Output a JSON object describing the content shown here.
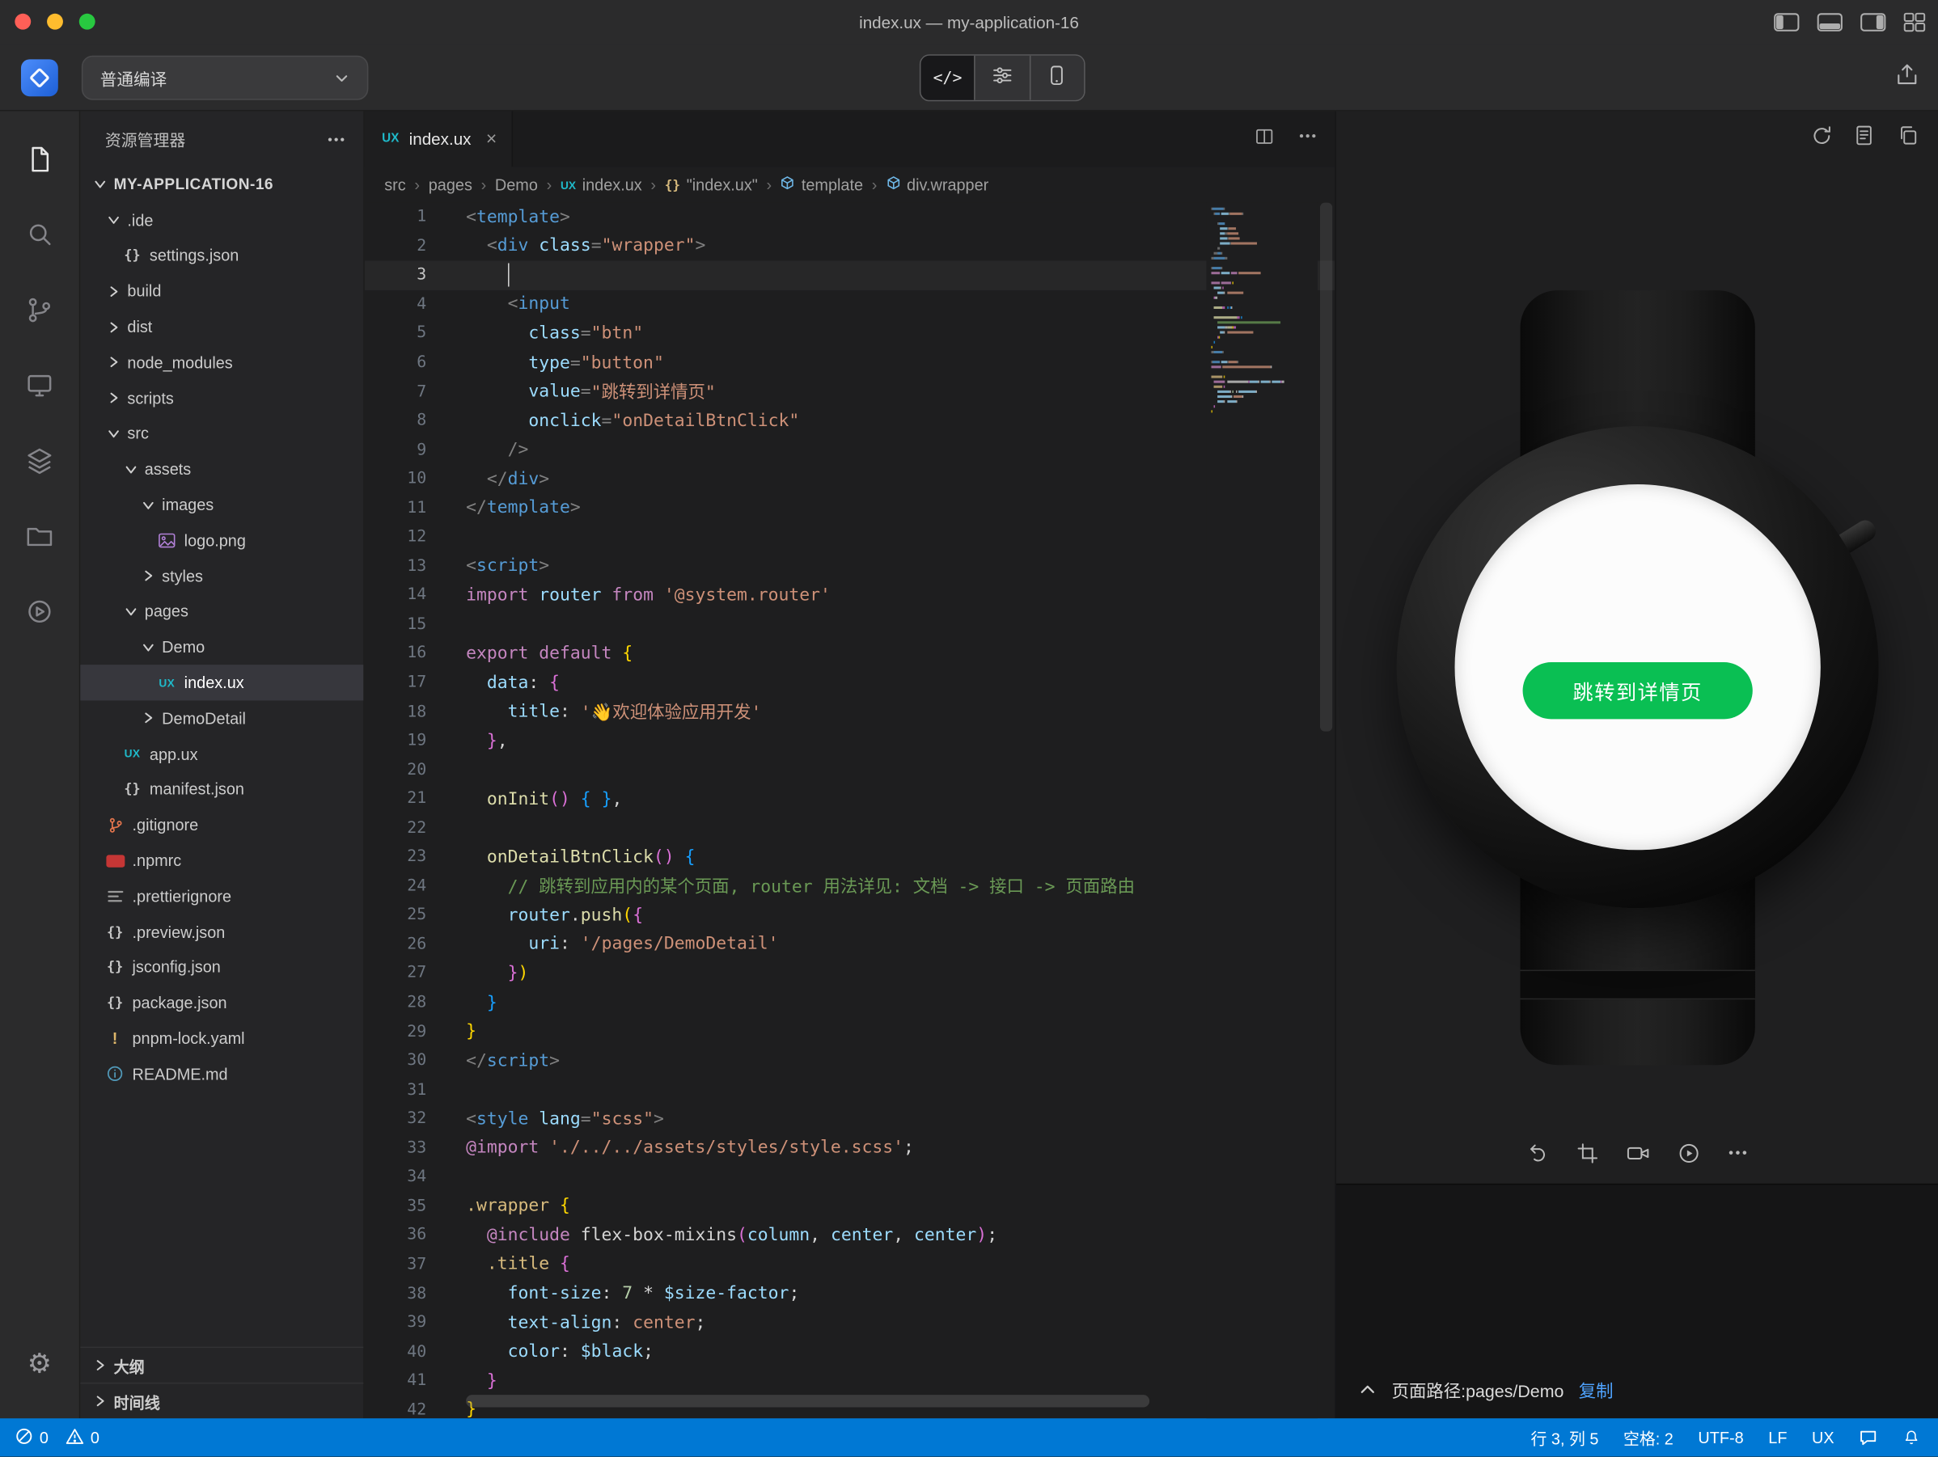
{
  "window": {
    "title": "index.ux — my-application-16"
  },
  "toolbar": {
    "compile_mode": "普通编译",
    "code_segment_label": "</>"
  },
  "colors": {
    "statusbar": "#0078d4",
    "button_green": "#0abf53",
    "ux_badge": "#1fb9c9",
    "link_blue": "#4fa3ff"
  },
  "sidebar": {
    "header": "资源管理器",
    "project": "MY-APPLICATION-16",
    "items": [
      {
        "label": ".ide",
        "type": "folder",
        "exp": "open",
        "level": 1
      },
      {
        "label": "settings.json",
        "type": "file",
        "icon": "json",
        "level": 2
      },
      {
        "label": "build",
        "type": "folder",
        "exp": "closed",
        "level": 1
      },
      {
        "label": "dist",
        "type": "folder",
        "exp": "closed",
        "level": 1
      },
      {
        "label": "node_modules",
        "type": "folder",
        "exp": "closed",
        "level": 1
      },
      {
        "label": "scripts",
        "type": "folder",
        "exp": "closed",
        "level": 1
      },
      {
        "label": "src",
        "type": "folder",
        "exp": "open",
        "level": 1
      },
      {
        "label": "assets",
        "type": "folder",
        "exp": "open",
        "level": 2
      },
      {
        "label": "images",
        "type": "folder",
        "exp": "open",
        "level": 3
      },
      {
        "label": "logo.png",
        "type": "file",
        "icon": "image",
        "level": 4
      },
      {
        "label": "styles",
        "type": "folder",
        "exp": "closed",
        "level": 3
      },
      {
        "label": "pages",
        "type": "folder",
        "exp": "open",
        "level": 2
      },
      {
        "label": "Demo",
        "type": "folder",
        "exp": "open",
        "level": 3
      },
      {
        "label": "index.ux",
        "type": "file",
        "icon": "ux",
        "level": 4,
        "selected": true
      },
      {
        "label": "DemoDetail",
        "type": "folder",
        "exp": "closed",
        "level": 3
      },
      {
        "label": "app.ux",
        "type": "file",
        "icon": "ux",
        "level": 2
      },
      {
        "label": "manifest.json",
        "type": "file",
        "icon": "json",
        "level": 2
      },
      {
        "label": ".gitignore",
        "type": "file",
        "icon": "git",
        "level": 1
      },
      {
        "label": ".npmrc",
        "type": "file",
        "icon": "npm",
        "level": 1
      },
      {
        "label": ".prettierignore",
        "type": "file",
        "icon": "lines",
        "level": 1
      },
      {
        "label": ".preview.json",
        "type": "file",
        "icon": "json",
        "level": 1
      },
      {
        "label": "jsconfig.json",
        "type": "file",
        "icon": "json",
        "level": 1
      },
      {
        "label": "package.json",
        "type": "file",
        "icon": "json",
        "level": 1
      },
      {
        "label": "pnpm-lock.yaml",
        "type": "file",
        "icon": "warn",
        "level": 1
      },
      {
        "label": "README.md",
        "type": "file",
        "icon": "info",
        "level": 1
      }
    ],
    "footer": [
      "大纲",
      "时间线"
    ]
  },
  "editor": {
    "tab": {
      "icon": "UX",
      "label": "index.ux"
    },
    "breadcrumb": [
      {
        "label": "src"
      },
      {
        "label": "pages"
      },
      {
        "label": "Demo"
      },
      {
        "label": "index.ux",
        "icon": "ux"
      },
      {
        "label": "\"index.ux\"",
        "icon": "json"
      },
      {
        "label": "template",
        "icon": "symbol"
      },
      {
        "label": "div.wrapper",
        "icon": "symbol"
      }
    ],
    "cursor": {
      "line": 3,
      "col": 5
    },
    "palette": {
      "p": "#d4d4d4",
      "t": "#569cd6",
      "a": "#9cdcfe",
      "s": "#ce9178",
      "k": "#c586c0",
      "f": "#dcdcaa",
      "c": "#6a9955",
      "n": "#b5cea8",
      "g": "#808080",
      "b1": "#ffd700",
      "b2": "#da70d6",
      "b3": "#179fff",
      "sel": "#d7ba7d"
    },
    "lines": [
      [
        [
          "<",
          "g"
        ],
        [
          "template",
          "t"
        ],
        [
          ">",
          "g"
        ]
      ],
      [
        [
          "  ",
          "p"
        ],
        [
          "<",
          "g"
        ],
        [
          "div",
          "t"
        ],
        [
          " ",
          "p"
        ],
        [
          "class",
          "a"
        ],
        [
          "=",
          "g"
        ],
        [
          "\"wrapper\"",
          "s"
        ],
        [
          ">",
          "g"
        ]
      ],
      [
        [
          "    ",
          "p"
        ]
      ],
      [
        [
          "    ",
          "p"
        ],
        [
          "<",
          "g"
        ],
        [
          "input",
          "t"
        ]
      ],
      [
        [
          "      ",
          "p"
        ],
        [
          "class",
          "a"
        ],
        [
          "=",
          "g"
        ],
        [
          "\"btn\"",
          "s"
        ]
      ],
      [
        [
          "      ",
          "p"
        ],
        [
          "type",
          "a"
        ],
        [
          "=",
          "g"
        ],
        [
          "\"button\"",
          "s"
        ]
      ],
      [
        [
          "      ",
          "p"
        ],
        [
          "value",
          "a"
        ],
        [
          "=",
          "g"
        ],
        [
          "\"跳转到详情页\"",
          "s"
        ]
      ],
      [
        [
          "      ",
          "p"
        ],
        [
          "onclick",
          "a"
        ],
        [
          "=",
          "g"
        ],
        [
          "\"onDetailBtnClick\"",
          "s"
        ]
      ],
      [
        [
          "    ",
          "p"
        ],
        [
          "/>",
          "g"
        ]
      ],
      [
        [
          "  ",
          "p"
        ],
        [
          "</",
          "g"
        ],
        [
          "div",
          "t"
        ],
        [
          ">",
          "g"
        ]
      ],
      [
        [
          "</",
          "g"
        ],
        [
          "template",
          "t"
        ],
        [
          ">",
          "g"
        ]
      ],
      [],
      [
        [
          "<",
          "g"
        ],
        [
          "script",
          "t"
        ],
        [
          ">",
          "g"
        ]
      ],
      [
        [
          "import",
          "k"
        ],
        [
          " ",
          "p"
        ],
        [
          "router",
          "a"
        ],
        [
          " ",
          "p"
        ],
        [
          "from",
          "k"
        ],
        [
          " ",
          "p"
        ],
        [
          "'@system.router'",
          "s"
        ]
      ],
      [],
      [
        [
          "export",
          "k"
        ],
        [
          " ",
          "p"
        ],
        [
          "default",
          "k"
        ],
        [
          " ",
          "p"
        ],
        [
          "{",
          "b1"
        ]
      ],
      [
        [
          "  ",
          "p"
        ],
        [
          "data",
          "a"
        ],
        [
          ":",
          "p"
        ],
        [
          " ",
          "p"
        ],
        [
          "{",
          "b2"
        ]
      ],
      [
        [
          "    ",
          "p"
        ],
        [
          "title",
          "a"
        ],
        [
          ":",
          "p"
        ],
        [
          " ",
          "p"
        ],
        [
          "'👋欢迎体验应用开发'",
          "s"
        ]
      ],
      [
        [
          "  ",
          "p"
        ],
        [
          "}",
          "b2"
        ],
        [
          ",",
          "p"
        ]
      ],
      [],
      [
        [
          "  ",
          "p"
        ],
        [
          "onInit",
          "f"
        ],
        [
          "(",
          "b2"
        ],
        [
          ")",
          "b2"
        ],
        [
          " ",
          "p"
        ],
        [
          "{",
          "b3"
        ],
        [
          " ",
          "p"
        ],
        [
          "}",
          "b3"
        ],
        [
          ",",
          "p"
        ]
      ],
      [],
      [
        [
          "  ",
          "p"
        ],
        [
          "onDetailBtnClick",
          "f"
        ],
        [
          "(",
          "b2"
        ],
        [
          ")",
          "b2"
        ],
        [
          " ",
          "p"
        ],
        [
          "{",
          "b3"
        ]
      ],
      [
        [
          "    ",
          "p"
        ],
        [
          "// 跳转到应用内的某个页面, router 用法详见: 文档 -> 接口 -> 页面路由",
          "c"
        ]
      ],
      [
        [
          "    ",
          "p"
        ],
        [
          "router",
          "a"
        ],
        [
          ".",
          "p"
        ],
        [
          "push",
          "f"
        ],
        [
          "(",
          "b1"
        ],
        [
          "{",
          "b2"
        ]
      ],
      [
        [
          "      ",
          "p"
        ],
        [
          "uri",
          "a"
        ],
        [
          ":",
          "p"
        ],
        [
          " ",
          "p"
        ],
        [
          "'/pages/DemoDetail'",
          "s"
        ]
      ],
      [
        [
          "    ",
          "p"
        ],
        [
          "}",
          "b2"
        ],
        [
          ")",
          "b1"
        ]
      ],
      [
        [
          "  ",
          "p"
        ],
        [
          "}",
          "b3"
        ]
      ],
      [
        [
          "}",
          "b1"
        ]
      ],
      [
        [
          "</",
          "g"
        ],
        [
          "script",
          "t"
        ],
        [
          ">",
          "g"
        ]
      ],
      [],
      [
        [
          "<",
          "g"
        ],
        [
          "style",
          "t"
        ],
        [
          " ",
          "p"
        ],
        [
          "lang",
          "a"
        ],
        [
          "=",
          "g"
        ],
        [
          "\"scss\"",
          "s"
        ],
        [
          ">",
          "g"
        ]
      ],
      [
        [
          "@import",
          "k"
        ],
        [
          " ",
          "p"
        ],
        [
          "'./../../assets/styles/style.scss'",
          "s"
        ],
        [
          ";",
          "p"
        ]
      ],
      [],
      [
        [
          ".wrapper",
          "sel"
        ],
        [
          " ",
          "p"
        ],
        [
          "{",
          "b1"
        ]
      ],
      [
        [
          "  ",
          "p"
        ],
        [
          "@include",
          "k"
        ],
        [
          " ",
          "p"
        ],
        [
          "flex-box-mixins",
          "p"
        ],
        [
          "(",
          "b2"
        ],
        [
          "column",
          "a"
        ],
        [
          ",",
          "p"
        ],
        [
          " ",
          "p"
        ],
        [
          "center",
          "a"
        ],
        [
          ",",
          "p"
        ],
        [
          " ",
          "p"
        ],
        [
          "center",
          "a"
        ],
        [
          ")",
          "b2"
        ],
        [
          ";",
          "p"
        ]
      ],
      [
        [
          "  ",
          "p"
        ],
        [
          ".title",
          "sel"
        ],
        [
          " ",
          "p"
        ],
        [
          "{",
          "b2"
        ]
      ],
      [
        [
          "    ",
          "p"
        ],
        [
          "font-size",
          "a"
        ],
        [
          ":",
          "p"
        ],
        [
          " ",
          "p"
        ],
        [
          "7",
          "n"
        ],
        [
          " ",
          "p"
        ],
        [
          "*",
          "p"
        ],
        [
          " ",
          "p"
        ],
        [
          "$size-factor",
          "a"
        ],
        [
          ";",
          "p"
        ]
      ],
      [
        [
          "    ",
          "p"
        ],
        [
          "text-align",
          "a"
        ],
        [
          ":",
          "p"
        ],
        [
          " ",
          "p"
        ],
        [
          "center",
          "s"
        ],
        [
          ";",
          "p"
        ]
      ],
      [
        [
          "    ",
          "p"
        ],
        [
          "color",
          "a"
        ],
        [
          ":",
          "p"
        ],
        [
          " ",
          "p"
        ],
        [
          "$black",
          "a"
        ],
        [
          ";",
          "p"
        ]
      ],
      [
        [
          "  ",
          "p"
        ],
        [
          "}",
          "b2"
        ]
      ],
      [
        [
          "}",
          "b1"
        ]
      ]
    ]
  },
  "preview": {
    "button_label": "跳转到详情页",
    "footer": {
      "path": "页面路径:pages/Demo",
      "copy": "复制"
    }
  },
  "status_bar": {
    "errors": "0",
    "warnings": "0",
    "position": "行 3, 列 5",
    "indent": "空格: 2",
    "encoding": "UTF-8",
    "eol": "LF",
    "lang": "UX"
  }
}
